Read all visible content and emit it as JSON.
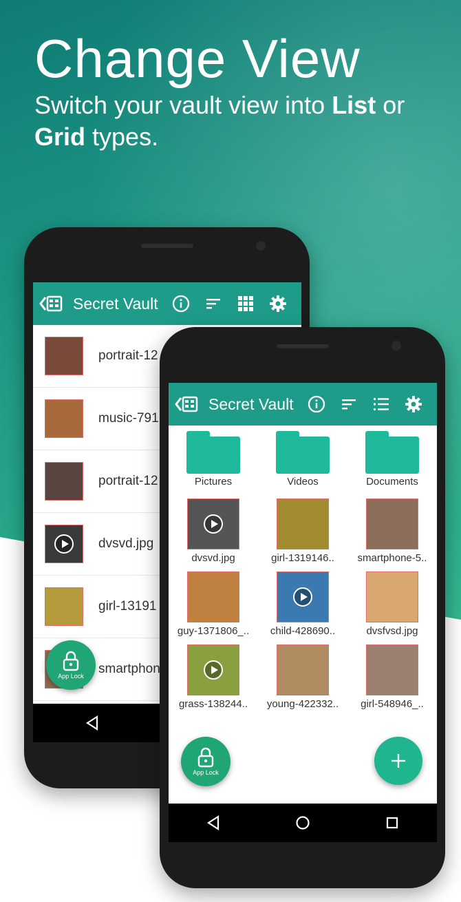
{
  "promo": {
    "headline": "Change View",
    "sub_prefix": "Switch your vault view into ",
    "sub_bold1": "List",
    "sub_mid": " or ",
    "sub_bold2": "Grid",
    "sub_suffix": " types."
  },
  "back_phone": {
    "app_title": "Secret Vault",
    "toolbar_icons": [
      "info-icon",
      "sort-icon",
      "grid-view-icon",
      "settings-icon"
    ],
    "items": [
      {
        "name": "portrait-12",
        "thumb_color": "#7a4a3a",
        "video": false
      },
      {
        "name": "music-791",
        "thumb_color": "#a86a3a",
        "video": false
      },
      {
        "name": "portrait-12",
        "thumb_color": "#5a4440",
        "video": false
      },
      {
        "name": "dvsvd.jpg",
        "thumb_color": "#3a3a3a",
        "video": true
      },
      {
        "name": "girl-13191",
        "thumb_color": "#b49a3a",
        "video": false
      },
      {
        "name": "smartphon",
        "thumb_color": "#8a6a50",
        "video": false
      }
    ],
    "fab_label": "App Lock"
  },
  "front_phone": {
    "app_title": "Secret Vault",
    "toolbar_icons": [
      "info-icon",
      "sort-icon",
      "list-view-icon",
      "settings-icon"
    ],
    "folders": [
      "Pictures",
      "Videos",
      "Documents"
    ],
    "files": [
      {
        "name": "dvsvd.jpg",
        "thumb_color": "#555555",
        "video": true
      },
      {
        "name": "girl-1319146..",
        "thumb_color": "#a28a30",
        "video": false
      },
      {
        "name": "smartphone-5..",
        "thumb_color": "#8a6e5a",
        "video": false
      },
      {
        "name": "guy-1371806_..",
        "thumb_color": "#c08040",
        "video": false
      },
      {
        "name": "child-428690..",
        "thumb_color": "#3a7ab0",
        "video": true
      },
      {
        "name": "dvsfvsd.jpg",
        "thumb_color": "#d9a870",
        "video": false
      },
      {
        "name": "grass-138244..",
        "thumb_color": "#8aa040",
        "video": true
      },
      {
        "name": "young-422332..",
        "thumb_color": "#b08a60",
        "video": false
      },
      {
        "name": "girl-548946_..",
        "thumb_color": "#9a8070",
        "video": false
      }
    ],
    "fab_label": "App Lock"
  },
  "colors": {
    "accent": "#1e9c89",
    "folder": "#1eb99b",
    "fab_lock": "#20a575",
    "fab_add": "#1fb58e"
  }
}
